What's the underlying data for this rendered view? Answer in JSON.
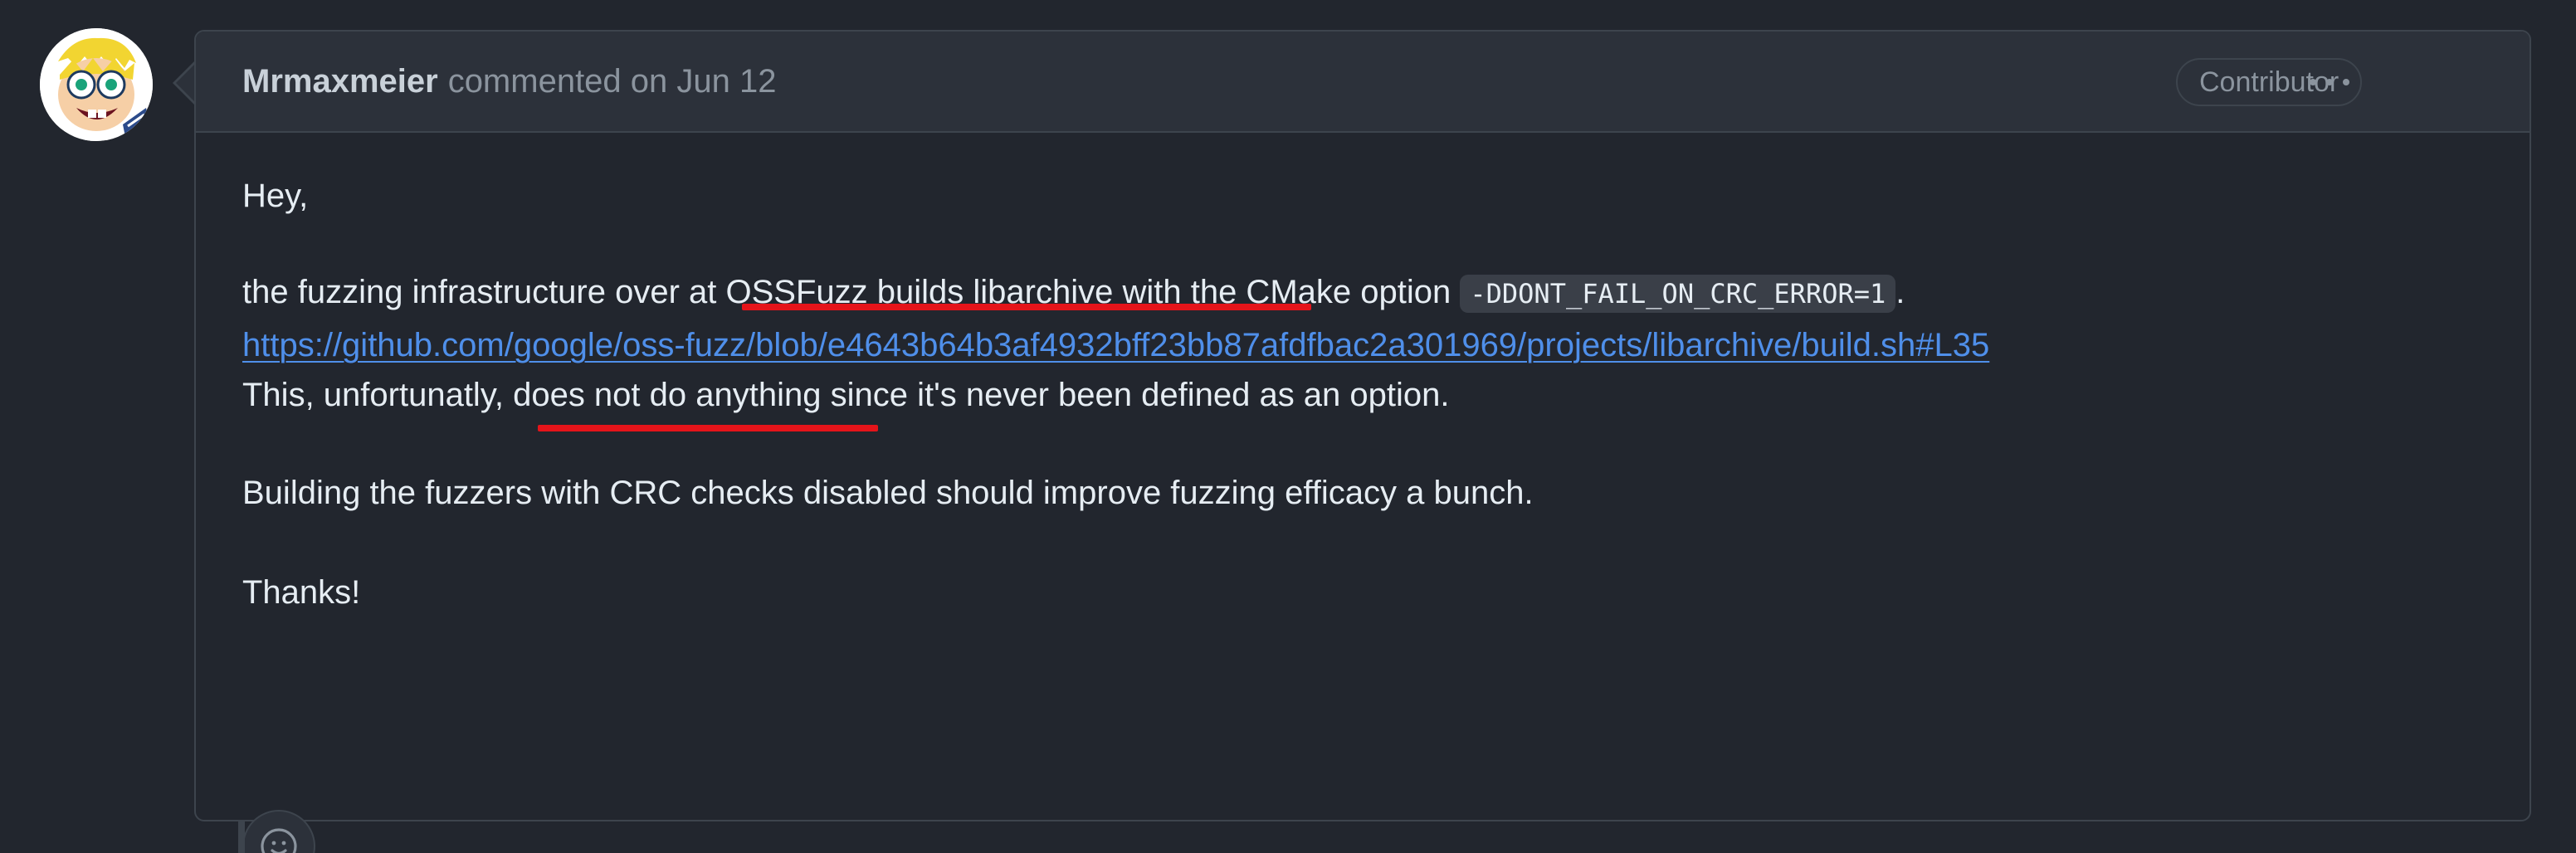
{
  "comment": {
    "author": "Mrmaxmeier",
    "meta": "commented on Jun 12",
    "role_badge": "Contributor",
    "body": {
      "greeting": "Hey,",
      "line1_prefix": "the fuzzing infrastructure over at OSSFuzz builds libarchive with the CMake option",
      "line1_code": "-DDONT_FAIL_ON_CRC_ERROR=1",
      "line1_suffix": ".",
      "link": "https://github.com/google/oss-fuzz/blob/e4643b64b3af4932bff23bb87afdfbac2a301969/projects/libarchive/build.sh#L35",
      "line3": "This, unfortunatly, does not do anything since it's never been defined as an option.",
      "paragraph2": "Building the fuzzers with CRC checks disabled should improve fuzzing efficacy a bunch.",
      "signoff": "Thanks!"
    }
  },
  "icons": {
    "avatar": "avatar",
    "more": "kebab-horizontal-icon",
    "reaction": "smiley-icon"
  },
  "colors": {
    "background": "#22262e",
    "header": "#2c313a",
    "border": "#3d444d",
    "link": "#4f8fea",
    "annotation": "#e5141a"
  }
}
